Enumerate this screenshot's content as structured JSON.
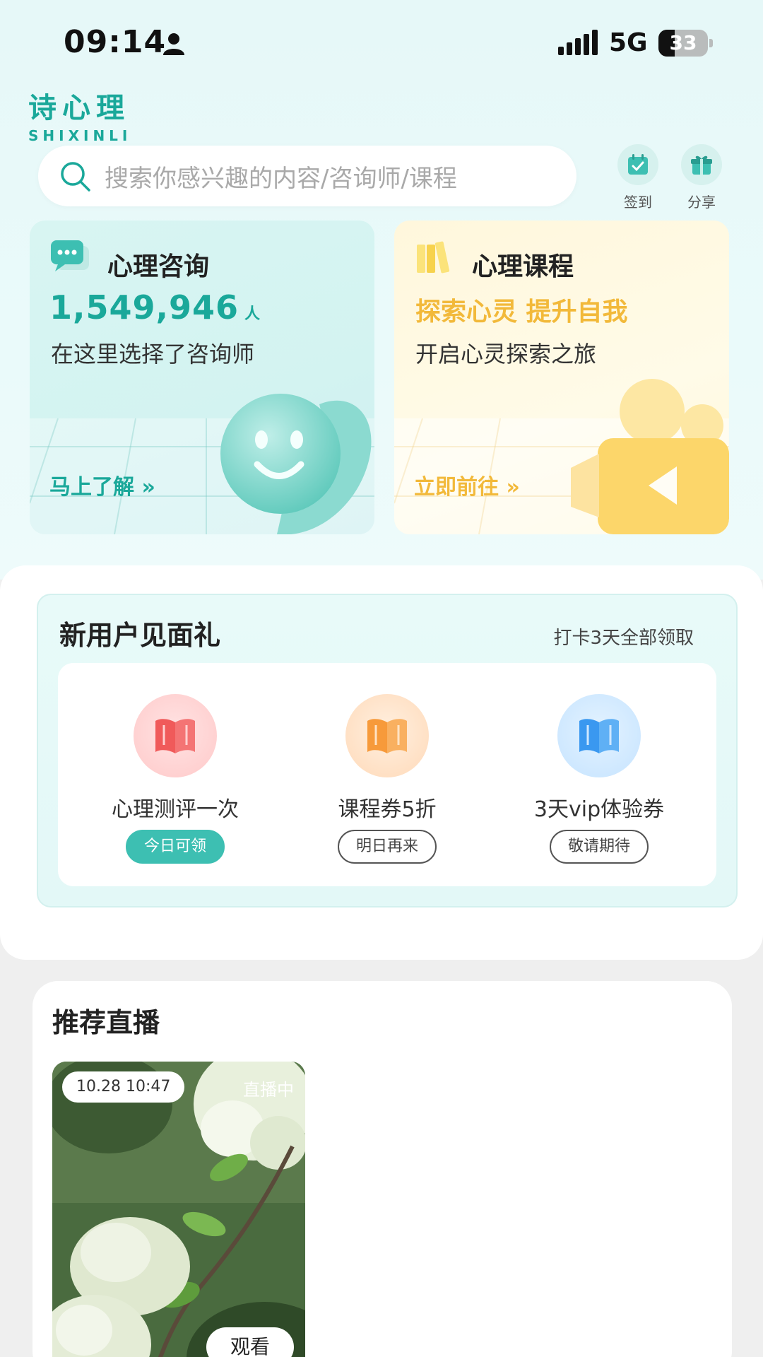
{
  "status_bar": {
    "time": "09:14",
    "network": "5G",
    "battery": "33",
    "battery_level": 0.33
  },
  "logo": {
    "cn": "诗心理",
    "en": "SHIXINLI"
  },
  "search": {
    "placeholder": "搜索你感兴趣的内容/咨询师/课程"
  },
  "top_actions": [
    {
      "label": "签到",
      "icon": "calendar-check-icon"
    },
    {
      "label": "分享",
      "icon": "gift-icon"
    }
  ],
  "cards": {
    "consult": {
      "title": "心理咨询",
      "number": "1,549,946",
      "unit": "人",
      "desc": "在这里选择了咨询师",
      "link": "马上了解 »"
    },
    "course": {
      "title": "心理课程",
      "highlight": "探索心灵 提升自我",
      "desc": "开启心灵探索之旅",
      "link": "立即前往 »"
    }
  },
  "gift": {
    "title": "新用户见面礼",
    "subtitle": "打卡3天全部领取",
    "items": [
      {
        "label": "心理测评一次",
        "button": "今日可领",
        "color": "#f05a5a"
      },
      {
        "label": "课程券5折",
        "button": "明日再来",
        "color": "#f79a3a"
      },
      {
        "label": "3天vip体验券",
        "button": "敬请期待",
        "color": "#3a98f0"
      }
    ]
  },
  "live": {
    "title": "推荐直播",
    "card": {
      "date": "10.28 10:47",
      "status": "直播中",
      "watch": "观看"
    }
  },
  "colors": {
    "accent": "#1aa89a",
    "gold": "#f2b93a",
    "teal_button": "#3dbfb2"
  }
}
